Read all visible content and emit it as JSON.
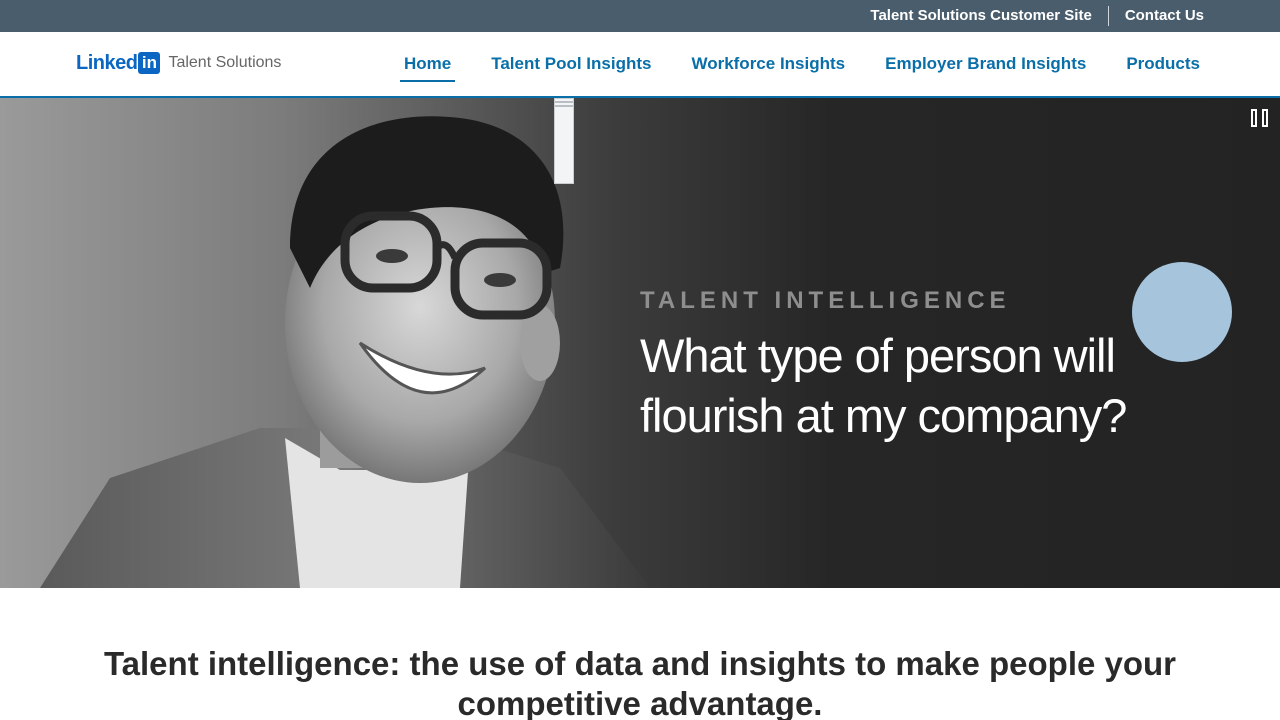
{
  "utility_bar": {
    "customer_site": "Talent Solutions Customer Site",
    "contact": "Contact Us"
  },
  "brand": {
    "logo_word": "Linked",
    "logo_in": "in",
    "product": "Talent Solutions"
  },
  "nav": {
    "items": [
      {
        "label": "Home",
        "active": true
      },
      {
        "label": "Talent Pool Insights"
      },
      {
        "label": "Workforce Insights"
      },
      {
        "label": "Employer Brand Insights"
      },
      {
        "label": "Products"
      }
    ]
  },
  "hero": {
    "eyebrow": "TALENT INTELLIGENCE",
    "headline_line1": "What type of person will",
    "headline_line2": "flourish at my company?",
    "pause_icon": "pause-icon",
    "accent_color": "#a6c5dc"
  },
  "intro": {
    "heading": "Talent intelligence: the use of data and insights to make people your competitive advantage."
  },
  "colors": {
    "utility_bg": "#4a5d6c",
    "link": "#0a6fa9",
    "brand_blue": "#0a66c2"
  }
}
